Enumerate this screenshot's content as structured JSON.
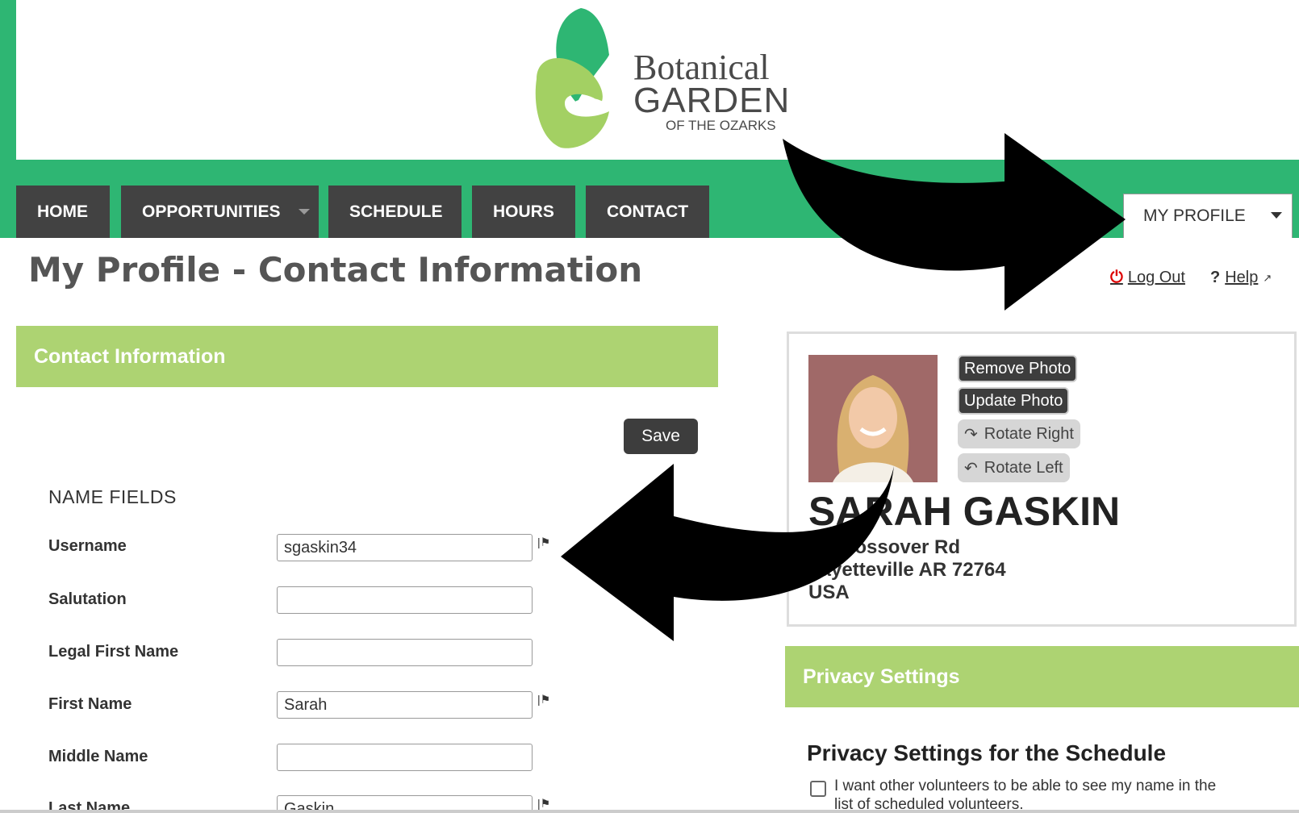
{
  "logo": {
    "line1": "Botanical",
    "line2": "GARDEN",
    "line3": "OF THE OZARKS",
    "icon": "butterfly-leaf-logo"
  },
  "nav": {
    "tabs": [
      {
        "label": "HOME"
      },
      {
        "label": "OPPORTUNITIES"
      },
      {
        "label": "SCHEDULE"
      },
      {
        "label": "HOURS"
      },
      {
        "label": "CONTACT"
      }
    ],
    "profile_menu": "MY PROFILE"
  },
  "page": {
    "title": "My Profile - Contact Information",
    "logout": "Log Out",
    "help": "Help"
  },
  "contact": {
    "header": "Contact Information",
    "save": "Save",
    "section": "NAME FIELDS",
    "fields": [
      {
        "label": "Username",
        "value": "sgaskin34",
        "flag": true
      },
      {
        "label": "Salutation",
        "value": "",
        "flag": false
      },
      {
        "label": "Legal First Name",
        "value": "",
        "flag": false
      },
      {
        "label": "First Name",
        "value": "Sarah",
        "flag": true
      },
      {
        "label": "Middle Name",
        "value": "",
        "flag": false
      },
      {
        "label": "Last Name",
        "value": "Gaskin",
        "flag": true
      }
    ]
  },
  "profile": {
    "remove_photo": "Remove Photo",
    "update_photo": "Update Photo",
    "rotate_right": "Rotate Right",
    "rotate_left": "Rotate Left",
    "name": "SARAH GASKIN",
    "address1": "N. Crossover Rd",
    "address2": "Fayetteville AR 72764",
    "country": "USA"
  },
  "privacy": {
    "header": "Privacy Settings",
    "title": "Privacy Settings for the Schedule",
    "checkbox_text": "I want other volunteers to be able to see my name in the list of scheduled volunteers."
  },
  "colors": {
    "brand_green": "#2eb673",
    "panel_green": "#add372",
    "tab_dark": "#424242"
  }
}
